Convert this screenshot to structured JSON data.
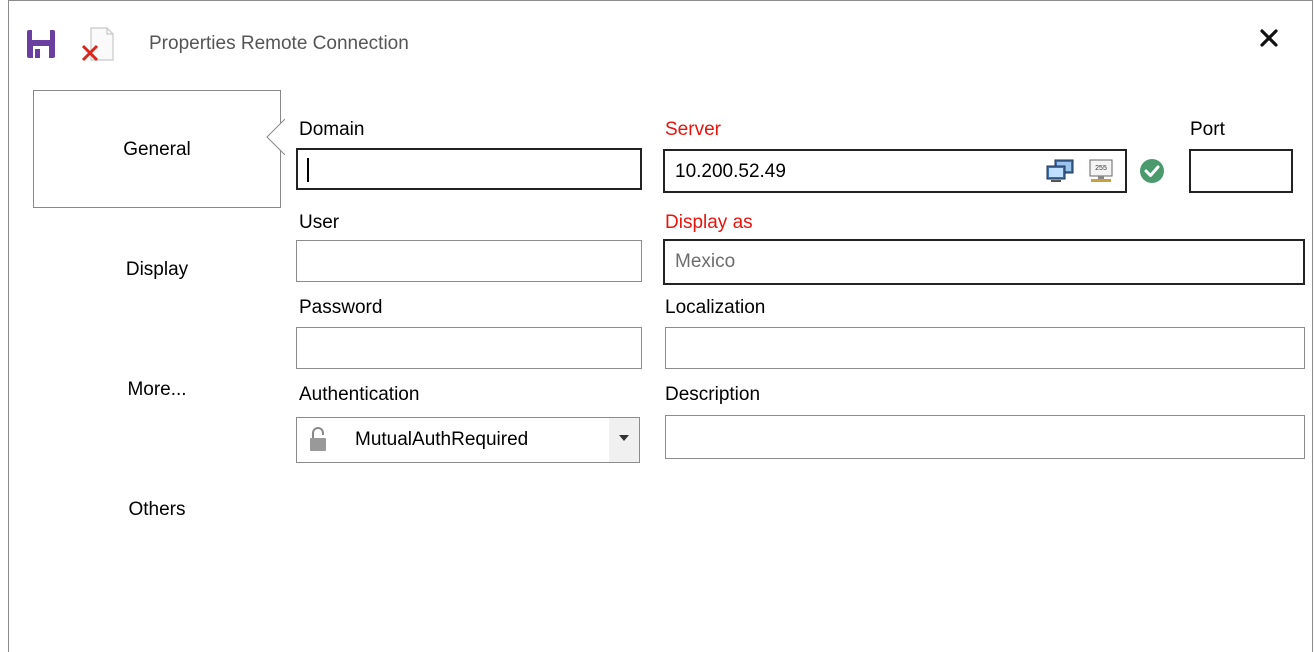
{
  "window": {
    "title": "Properties Remote Connection"
  },
  "toolbar": {
    "save_icon": "floppy-disk-icon",
    "discard_icon": "delete-document-icon",
    "close_icon": "close-icon"
  },
  "nav": {
    "items": [
      {
        "label": "General",
        "selected": true
      },
      {
        "label": "Display",
        "selected": false
      },
      {
        "label": "More...",
        "selected": false
      },
      {
        "label": "Others",
        "selected": false
      }
    ]
  },
  "form": {
    "domain": {
      "label": "Domain",
      "value": ""
    },
    "server": {
      "label": "Server",
      "value": "10.200.52.49",
      "required": true,
      "status": "valid"
    },
    "port": {
      "label": "Port",
      "value": ""
    },
    "user": {
      "label": "User",
      "value": ""
    },
    "display_as": {
      "label": "Display as",
      "value": "",
      "placeholder": "Mexico",
      "required": true
    },
    "password": {
      "label": "Password",
      "value": ""
    },
    "localization": {
      "label": "Localization",
      "value": ""
    },
    "authentication": {
      "label": "Authentication",
      "value": "MutualAuthRequired",
      "icon": "lock-icon"
    },
    "description": {
      "label": "Description",
      "value": ""
    }
  },
  "colors": {
    "required_label": "#e8140d",
    "save_icon": "#6b3fa0",
    "discard_icon": "#d9261c",
    "valid_check": "#4a9a6e"
  }
}
